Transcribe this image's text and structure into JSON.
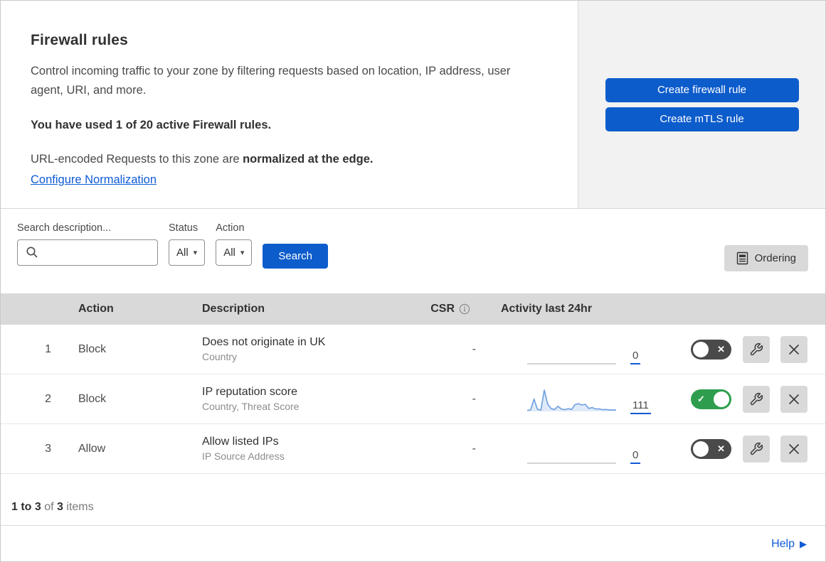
{
  "header": {
    "title": "Firewall rules",
    "description": "Control incoming traffic to your zone by filtering requests based on location, IP address, user agent, URI, and more.",
    "usage_notice": "You have used 1 of 20 active Firewall rules.",
    "normalization_prefix": "URL-encoded Requests to this zone are ",
    "normalization_bold": "normalized at the edge.",
    "normalization_link": "Configure Normalization",
    "create_firewall_button": "Create firewall rule",
    "create_mtls_button": "Create mTLS rule"
  },
  "filters": {
    "search_label": "Search description...",
    "search_value": "",
    "status_label": "Status",
    "status_value": "All",
    "action_label": "Action",
    "action_value": "All",
    "search_button": "Search",
    "ordering_button": "Ordering"
  },
  "table": {
    "columns": {
      "action": "Action",
      "description": "Description",
      "csr": "CSR",
      "activity": "Activity last 24hr"
    },
    "rows": [
      {
        "priority": "1",
        "action": "Block",
        "description": "Does not originate in UK",
        "fields": "Country",
        "csr": "-",
        "activity_count": "0",
        "enabled": false
      },
      {
        "priority": "2",
        "action": "Block",
        "description": "IP reputation score",
        "fields": "Country, Threat Score",
        "csr": "-",
        "activity_count": "111",
        "enabled": true
      },
      {
        "priority": "3",
        "action": "Allow",
        "description": "Allow listed IPs",
        "fields": "IP Source Address",
        "csr": "-",
        "activity_count": "0",
        "enabled": false
      }
    ]
  },
  "footer": {
    "range": "1 to 3",
    "of_text": "of",
    "total": "3",
    "items_text": "items",
    "help_label": "Help"
  },
  "icons": {
    "chevron_down": "▾",
    "toggle_off_glyph": "✕",
    "toggle_on_glyph": "✓",
    "help_arrow": "▶"
  },
  "colors": {
    "primary_blue": "#0d5ccc",
    "link_blue": "#0f5bd6",
    "toggle_on_green": "#2e9e4e",
    "toggle_off_gray": "#4a4a4a",
    "panel_gray": "#f2f2f2",
    "header_gray": "#d9d9d9",
    "sparkline_blue": "#6d9ee0"
  },
  "chart_data": {
    "type": "area",
    "title": "Activity last 24hr sparkline (rule 2: IP reputation score)",
    "x_range": "last 24 hours",
    "total_events": 111,
    "ylim": [
      0,
      100
    ],
    "grid": false,
    "values_relative": [
      4,
      7,
      58,
      10,
      6,
      100,
      34,
      13,
      9,
      24,
      11,
      8,
      13,
      9,
      32,
      36,
      30,
      33,
      14,
      18,
      11,
      12,
      8,
      9,
      7,
      7,
      6
    ],
    "line_color": "#6d9ee0",
    "fill_color": "rgba(109,158,224,0.22)"
  }
}
